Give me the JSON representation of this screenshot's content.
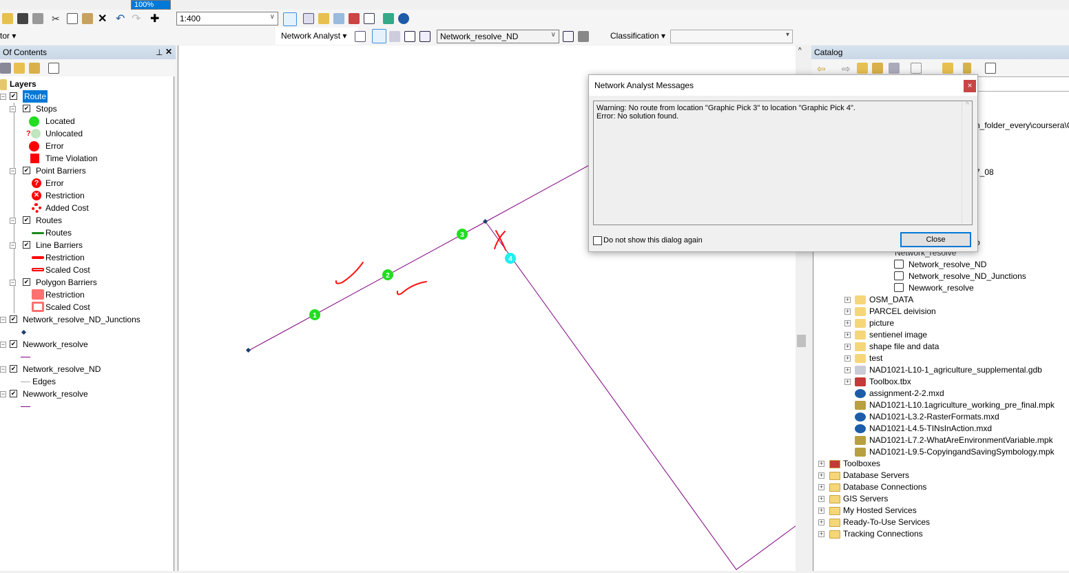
{
  "toolbar": {
    "scale": "1:400",
    "zoom_partial": "100%",
    "network_analyst_label": "Network Analyst",
    "editor_partial": "tor",
    "network_dataset": "Network_resolve_ND",
    "classification_label": "Classification",
    "classification_value": ""
  },
  "toc": {
    "title": "Of Contents",
    "root": "Layers",
    "items": [
      {
        "label": "Route",
        "level": 0,
        "checked": true,
        "selected": true
      },
      {
        "label": "Stops",
        "level": 1,
        "checked": true
      },
      {
        "label": "Located",
        "level": 2,
        "symbol": "green-circle"
      },
      {
        "label": "Unlocated",
        "level": 2,
        "symbol": "pale-green-circle-question"
      },
      {
        "label": "Error",
        "level": 2,
        "symbol": "red-circle"
      },
      {
        "label": "Time Violation",
        "level": 2,
        "symbol": "red-square"
      },
      {
        "label": "Point Barriers",
        "level": 1,
        "checked": true
      },
      {
        "label": "Error",
        "level": 2,
        "symbol": "red-question-circle"
      },
      {
        "label": "Restriction",
        "level": 2,
        "symbol": "red-x-circle"
      },
      {
        "label": "Added Cost",
        "level": 2,
        "symbol": "red-ring"
      },
      {
        "label": "Routes",
        "level": 1,
        "checked": true
      },
      {
        "label": "Routes",
        "level": 2,
        "symbol": "green-line"
      },
      {
        "label": "Line Barriers",
        "level": 1,
        "checked": true
      },
      {
        "label": "Restriction",
        "level": 2,
        "symbol": "red-line"
      },
      {
        "label": "Scaled Cost",
        "level": 2,
        "symbol": "red-hollow-line"
      },
      {
        "label": "Polygon Barriers",
        "level": 1,
        "checked": true
      },
      {
        "label": "Restriction",
        "level": 2,
        "symbol": "red-polygon"
      },
      {
        "label": "Scaled Cost",
        "level": 2,
        "symbol": "red-hollow-polygon"
      },
      {
        "label": "Network_resolve_ND_Junctions",
        "level": 0,
        "checked": true
      },
      {
        "label": "",
        "level": 3,
        "symbol": "junction-dot"
      },
      {
        "label": "Newwork_resolve",
        "level": 0,
        "checked": true
      },
      {
        "label": "",
        "level": 3,
        "symbol": "purple-line"
      },
      {
        "label": "Network_resolve_ND",
        "level": 0,
        "checked": true
      },
      {
        "label": "Edges",
        "level": 3,
        "symbol": "gray-line"
      },
      {
        "label": "Newwork_resolve",
        "level": 0,
        "checked": true
      },
      {
        "label": "",
        "level": 3,
        "symbol": "purple-line"
      }
    ]
  },
  "map": {
    "stops": [
      "1",
      "2",
      "3",
      "4"
    ],
    "line_color": "#800080",
    "stop_located_color": "#22dd22",
    "stop_unlocated_color": "#22eeee",
    "annotation_color": "#ff0000"
  },
  "dialog": {
    "title": "Network Analyst Messages",
    "messages": [
      "Warning: No route from location \"Graphic Pick 3\" to location \"Graphic Pick 4\".",
      "Error: No solution found."
    ],
    "checkbox_label": "Do not show this dialog again",
    "close_label": "Close",
    "close_x": "×"
  },
  "catalog": {
    "title": "Catalog",
    "partial_rows": [
      "n_folder_every\\coursera\\G",
      "7_08",
      "o"
    ],
    "gdb_parent": "Network_resolve",
    "gdb_children": [
      "Network_resolve_ND",
      "Network_resolve_ND_Junctions",
      "Newwork_resolve"
    ],
    "folder_items": [
      {
        "label": "OSM_DATA",
        "type": "folder",
        "expandable": true
      },
      {
        "label": "PARCEL deivision",
        "type": "folder",
        "expandable": true
      },
      {
        "label": "picture",
        "type": "folder",
        "expandable": true
      },
      {
        "label": "sentienel image",
        "type": "folder",
        "expandable": true
      },
      {
        "label": "shape file and data",
        "type": "folder",
        "expandable": true
      },
      {
        "label": "test",
        "type": "folder",
        "expandable": true
      },
      {
        "label": "NAD1021-L10-1_agriculture_supplemental.gdb",
        "type": "gdb",
        "expandable": true
      },
      {
        "label": "Toolbox.tbx",
        "type": "toolbox",
        "expandable": true
      },
      {
        "label": "assignment-2-2.mxd",
        "type": "mxd"
      },
      {
        "label": "NAD1021-L10.1agriculture_working_pre_final.mpk",
        "type": "mpk"
      },
      {
        "label": "NAD1021-L3.2-RasterFormats.mxd",
        "type": "mxd"
      },
      {
        "label": "NAD1021-L4.5-TINsInAction.mxd",
        "type": "mxd"
      },
      {
        "label": "NAD1021-L7.2-WhatAreEnvironmentVariable.mpk",
        "type": "mpk"
      },
      {
        "label": "NAD1021-L9.5-CopyingandSavingSymbology.mpk",
        "type": "mpk"
      }
    ],
    "root_items": [
      "Toolboxes",
      "Database Servers",
      "Database Connections",
      "GIS Servers",
      "My Hosted Services",
      "Ready-To-Use Services",
      "Tracking Connections"
    ]
  }
}
